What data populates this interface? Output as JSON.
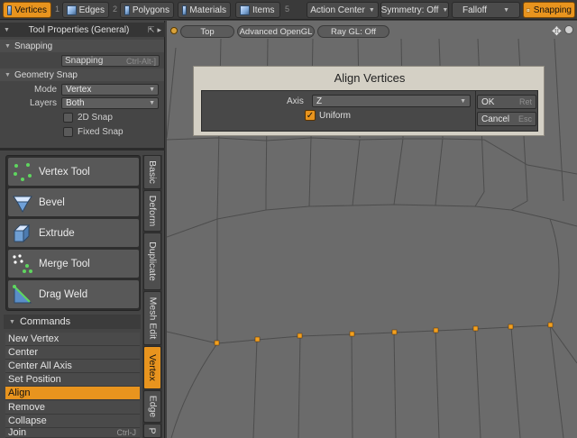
{
  "mode_tabs": [
    {
      "label": "Vertices",
      "num": "1",
      "icon": "vertex-cube-icon",
      "active": true
    },
    {
      "label": "Edges",
      "num": "2",
      "icon": "edge-cube-icon",
      "active": false
    },
    {
      "label": "Polygons",
      "num": "3",
      "icon": "polygon-cube-icon",
      "active": false
    },
    {
      "label": "Materials",
      "num": "",
      "icon": "material-cube-icon",
      "active": false
    },
    {
      "label": "Items",
      "num": "5",
      "icon": "item-cube-icon",
      "active": false
    }
  ],
  "toolbar": {
    "action_center": "Action Center",
    "symmetry": "Symmetry: Off",
    "falloff": "Falloff",
    "snapping": "Snapping"
  },
  "panel": {
    "title": "Tool Properties (General)",
    "snapping_section": "Snapping",
    "snapping_button": "Snapping",
    "snapping_shortcut": "Ctrl-Alt-]",
    "geometry_snap_section": "Geometry Snap",
    "mode_label": "Mode",
    "mode_value": "Vertex",
    "layers_label": "Layers",
    "layers_value": "Both",
    "snap2d_label": "2D Snap",
    "fixed_snap_label": "Fixed Snap"
  },
  "tools": [
    {
      "label": "Vertex Tool",
      "icon": "vertex-tool-icon"
    },
    {
      "label": "Bevel",
      "icon": "bevel-icon"
    },
    {
      "label": "Extrude",
      "icon": "extrude-icon"
    },
    {
      "label": "Merge Tool",
      "icon": "merge-tool-icon"
    },
    {
      "label": "Drag Weld",
      "icon": "drag-weld-icon"
    }
  ],
  "side_tabs": [
    {
      "label": "Basic",
      "active": false
    },
    {
      "label": "Deform",
      "active": false
    },
    {
      "label": "Duplicate",
      "active": false
    },
    {
      "label": "Mesh Edit",
      "active": false
    },
    {
      "label": "Vertex",
      "active": true
    },
    {
      "label": "Edge",
      "active": false
    },
    {
      "label": "P",
      "active": false
    }
  ],
  "commands": {
    "header": "Commands",
    "items": [
      {
        "label": "New Vertex",
        "shortcut": "",
        "active": false
      },
      {
        "label": "Center",
        "shortcut": "",
        "active": false
      },
      {
        "label": "Center All Axis",
        "shortcut": "",
        "active": false
      },
      {
        "label": "Set Position",
        "shortcut": "",
        "active": false
      },
      {
        "label": "Align",
        "shortcut": "",
        "active": true
      },
      {
        "label": "Remove",
        "shortcut": "",
        "active": false
      },
      {
        "label": "Collapse",
        "shortcut": "",
        "active": false
      },
      {
        "label": "Join",
        "shortcut": "Ctrl-J",
        "active": false
      }
    ]
  },
  "viewport": {
    "view_label": "Top",
    "shading_label": "Advanced OpenGL",
    "raygl_label": "Ray GL: Off"
  },
  "dialog": {
    "title": "Align Vertices",
    "axis_label": "Axis",
    "axis_value": "Z",
    "uniform_label": "Uniform",
    "uniform_checked": true,
    "ok_label": "OK",
    "ok_shortcut": "Ret",
    "cancel_label": "Cancel",
    "cancel_shortcut": "Esc"
  },
  "colors": {
    "accent": "#e8941e",
    "viewport_bg": "#6b6b6b",
    "selected_vertex": "#f2a020",
    "grid_line": "#4b4b4b"
  }
}
